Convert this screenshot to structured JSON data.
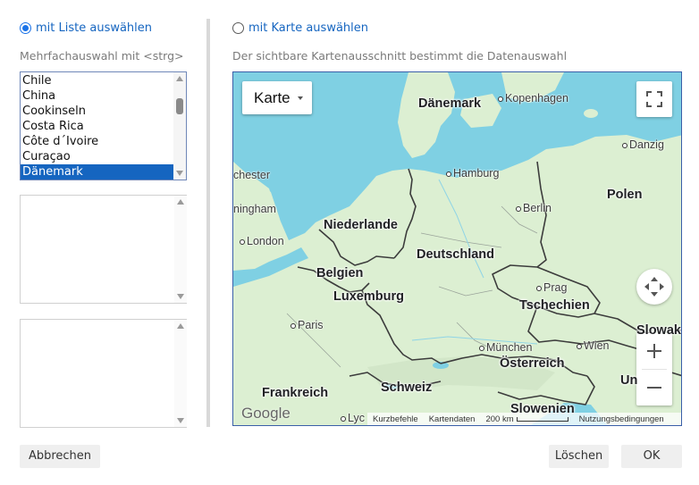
{
  "left_panel": {
    "radio_label": "mit Liste auswählen",
    "hint": "Mehrfachauswahl mit <strg>",
    "countries": [
      "Chile",
      "China",
      "Cookinseln",
      "Costa Rica",
      "Côte d´Ivoire",
      "Curaçao",
      "Dänemark"
    ],
    "selected_country": "Dänemark"
  },
  "right_panel": {
    "radio_label": "mit Karte auswählen",
    "hint": "Der sichtbare Kartenausschnitt bestimmt die Datenauswahl"
  },
  "map": {
    "map_type_label": "Karte",
    "google_logo_text": "Google",
    "countries": {
      "daenemark": "Dänemark",
      "niederlande": "Niederlande",
      "deutschland": "Deutschland",
      "polen": "Polen",
      "belgien": "Belgien",
      "luxemburg": "Luxemburg",
      "tschechien": "Tschechien",
      "slowakei": "Slowakei",
      "oesterreich": "Österreich",
      "frankreich": "Frankreich",
      "schweiz": "Schweiz",
      "slowenien": "Slowenien",
      "ungarn_partial": "Un"
    },
    "cities": {
      "kopenhagen": "Kopenhagen",
      "danzig": "Danzig",
      "hamburg": "Hamburg",
      "berlin": "Berlin",
      "london": "London",
      "paris": "Paris",
      "prag": "Prag",
      "muenchen": "München",
      "wien": "Wien",
      "lyon_partial": "Lyc",
      "manchester_partial": "chester",
      "birmingham_partial": "ningham"
    },
    "attribution": {
      "shortcuts": "Kurzbefehle",
      "map_data": "Kartendaten",
      "scale": "200 km",
      "terms": "Nutzungsbedingungen"
    },
    "colors": {
      "water": "#7fd0e3",
      "land": "#dcefd2",
      "border": "#3c3c3c"
    }
  },
  "footer": {
    "cancel_label": "Abbrechen",
    "delete_label": "Löschen",
    "ok_label": "OK"
  },
  "icons": [
    "radio-checked-icon",
    "radio-unchecked-icon",
    "fullscreen-icon",
    "camera-control-icon",
    "zoom-in-icon",
    "zoom-out-icon",
    "dropdown-caret-icon"
  ]
}
